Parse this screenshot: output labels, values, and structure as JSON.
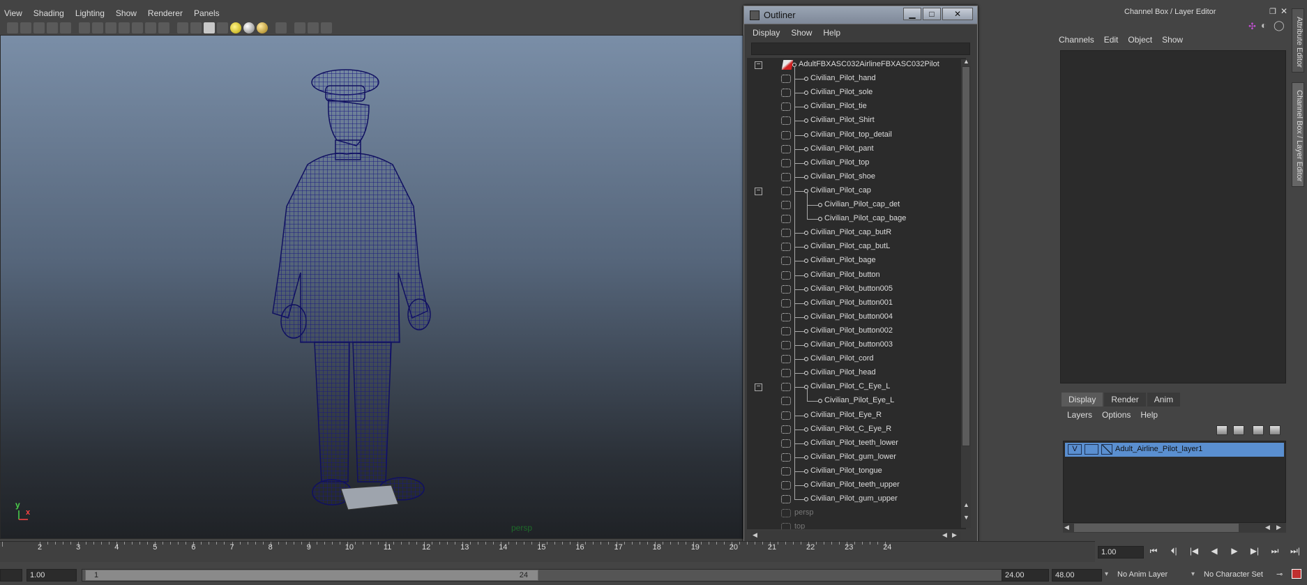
{
  "viewport": {
    "menu": [
      "View",
      "Shading",
      "Lighting",
      "Show",
      "Renderer",
      "Panels"
    ],
    "camera_label": "persp",
    "axis_y": "y",
    "axis_x": "x"
  },
  "outliner": {
    "title": "Outliner",
    "menu": [
      "Display",
      "Show",
      "Help"
    ],
    "window_buttons": {
      "minimize": "▁",
      "maximize": "□",
      "close": "✕"
    },
    "items": [
      {
        "label": "AdultFBXASC032AirlineFBXASC032Pilot",
        "depth": 0,
        "expander": "−",
        "icon": "root"
      },
      {
        "label": "Civilian_Pilot_hand",
        "depth": 1,
        "icon": "mesh"
      },
      {
        "label": "Civilian_Pilot_sole",
        "depth": 1,
        "icon": "mesh"
      },
      {
        "label": "Civilian_Pilot_tie",
        "depth": 1,
        "icon": "mesh"
      },
      {
        "label": "Civilian_Pilot_Shirt",
        "depth": 1,
        "icon": "mesh"
      },
      {
        "label": "Civilian_Pilot_top_detail",
        "depth": 1,
        "icon": "mesh"
      },
      {
        "label": "Civilian_Pilot_pant",
        "depth": 1,
        "icon": "mesh"
      },
      {
        "label": "Civilian_Pilot_top",
        "depth": 1,
        "icon": "mesh"
      },
      {
        "label": "Civilian_Pilot_shoe",
        "depth": 1,
        "icon": "mesh"
      },
      {
        "label": "Civilian_Pilot_cap",
        "depth": 1,
        "expander": "−",
        "icon": "mesh"
      },
      {
        "label": "Civilian_Pilot_cap_det",
        "depth": 2,
        "icon": "mesh"
      },
      {
        "label": "Civilian_Pilot_cap_bage",
        "depth": 2,
        "icon": "mesh"
      },
      {
        "label": "Civilian_Pilot_cap_butR",
        "depth": 1,
        "icon": "mesh"
      },
      {
        "label": "Civilian_Pilot_cap_butL",
        "depth": 1,
        "icon": "mesh"
      },
      {
        "label": "Civilian_Pilot_bage",
        "depth": 1,
        "icon": "mesh"
      },
      {
        "label": "Civilian_Pilot_button",
        "depth": 1,
        "icon": "mesh"
      },
      {
        "label": "Civilian_Pilot_button005",
        "depth": 1,
        "icon": "mesh"
      },
      {
        "label": "Civilian_Pilot_button001",
        "depth": 1,
        "icon": "mesh"
      },
      {
        "label": "Civilian_Pilot_button004",
        "depth": 1,
        "icon": "mesh"
      },
      {
        "label": "Civilian_Pilot_button002",
        "depth": 1,
        "icon": "mesh"
      },
      {
        "label": "Civilian_Pilot_button003",
        "depth": 1,
        "icon": "mesh"
      },
      {
        "label": "Civilian_Pilot_cord",
        "depth": 1,
        "icon": "mesh"
      },
      {
        "label": "Civilian_Pilot_head",
        "depth": 1,
        "icon": "mesh"
      },
      {
        "label": "Civilian_Pilot_C_Eye_L",
        "depth": 1,
        "expander": "−",
        "icon": "mesh"
      },
      {
        "label": "Civilian_Pilot_Eye_L",
        "depth": 2,
        "icon": "mesh"
      },
      {
        "label": "Civilian_Pilot_Eye_R",
        "depth": 1,
        "icon": "mesh"
      },
      {
        "label": "Civilian_Pilot_C_Eye_R",
        "depth": 1,
        "icon": "mesh"
      },
      {
        "label": "Civilian_Pilot_teeth_lower",
        "depth": 1,
        "icon": "mesh"
      },
      {
        "label": "Civilian_Pilot_gum_lower",
        "depth": 1,
        "icon": "mesh"
      },
      {
        "label": "Civilian_Pilot_tongue",
        "depth": 1,
        "icon": "mesh"
      },
      {
        "label": "Civilian_Pilot_teeth_upper",
        "depth": 1,
        "icon": "mesh"
      },
      {
        "label": "Civilian_Pilot_gum_upper",
        "depth": 1,
        "icon": "mesh"
      },
      {
        "label": "persp",
        "depth": 0,
        "icon": "camera",
        "dim": true
      },
      {
        "label": "top",
        "depth": 0,
        "icon": "camera",
        "dim": true
      }
    ]
  },
  "channel_box": {
    "title": "Channel Box / Layer Editor",
    "menu": [
      "Channels",
      "Edit",
      "Object",
      "Show"
    ],
    "side_tabs": [
      "Attribute Editor",
      "Channel Box / Layer Editor"
    ]
  },
  "layer_editor": {
    "tabs": [
      "Display",
      "Render",
      "Anim"
    ],
    "active_tab": "Display",
    "menu": [
      "Layers",
      "Options",
      "Help"
    ],
    "layer": {
      "visible": "V",
      "name": "Adult_Airline_Pilot_layer1"
    }
  },
  "timeline": {
    "ticks": [
      "2",
      "3",
      "4",
      "5",
      "6",
      "7",
      "8",
      "9",
      "10",
      "11",
      "12",
      "13",
      "14",
      "15",
      "16",
      "17",
      "18",
      "19",
      "20",
      "21",
      "22",
      "23",
      "24"
    ],
    "current_frame": "1.00",
    "playback_buttons": [
      "⏮",
      "⏴|",
      "|◀",
      "◀",
      "▶",
      "▶|",
      "⏭",
      "⏭|"
    ]
  },
  "range": {
    "start_field": "1.00",
    "handle_start": "1",
    "handle_end": "24",
    "end_field": "24.00",
    "max_field": "48.00",
    "anim_layer": "No Anim Layer",
    "character_set": "No Character Set"
  }
}
